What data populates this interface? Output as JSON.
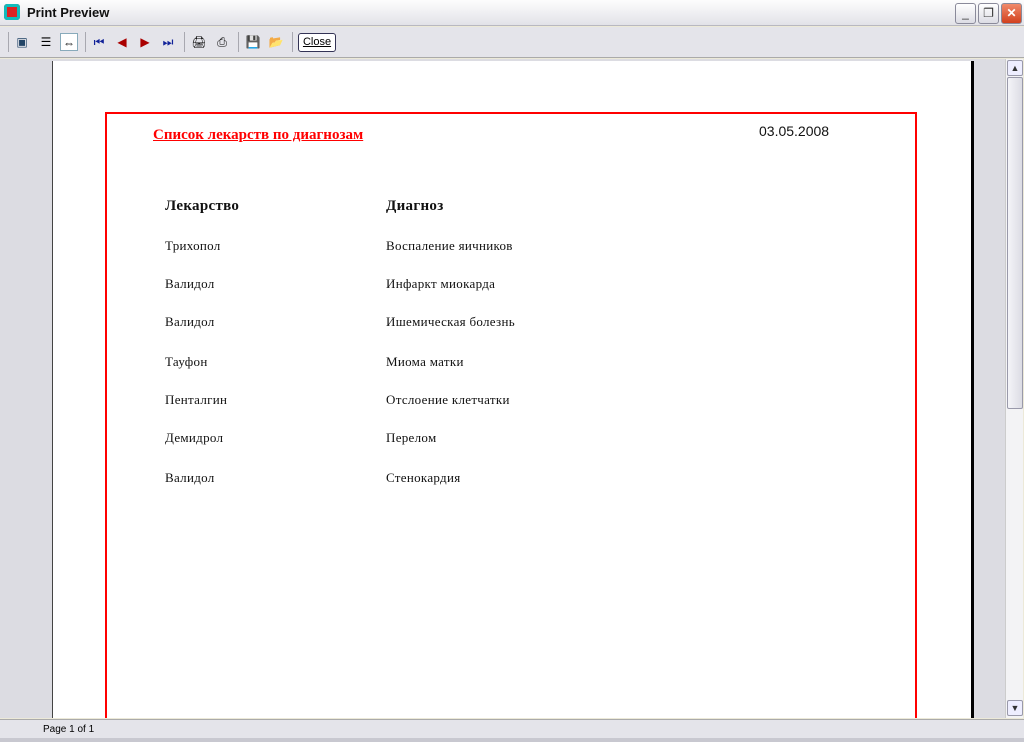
{
  "window": {
    "title": "Print Preview"
  },
  "toolbar": {
    "close_label": "Close"
  },
  "report": {
    "title": "Список лекарств по диагнозам",
    "date": "03.05.2008",
    "headers": [
      "Лекарство",
      "Диагноз"
    ],
    "rows": [
      [
        "Трихопол",
        "Воспаление яичников"
      ],
      [
        "Валидол",
        "Инфаркт миокарда"
      ],
      [
        "Валидол",
        "Ишемическая болезнь"
      ],
      [
        "Тауфон",
        "Миома матки"
      ],
      [
        "Пенталгин",
        "Отслоение клетчатки"
      ],
      [
        "Демидрол",
        "Перелом"
      ],
      [
        "Валидол",
        "Стенокардия"
      ]
    ]
  },
  "status": {
    "page": "Page 1 of 1"
  }
}
